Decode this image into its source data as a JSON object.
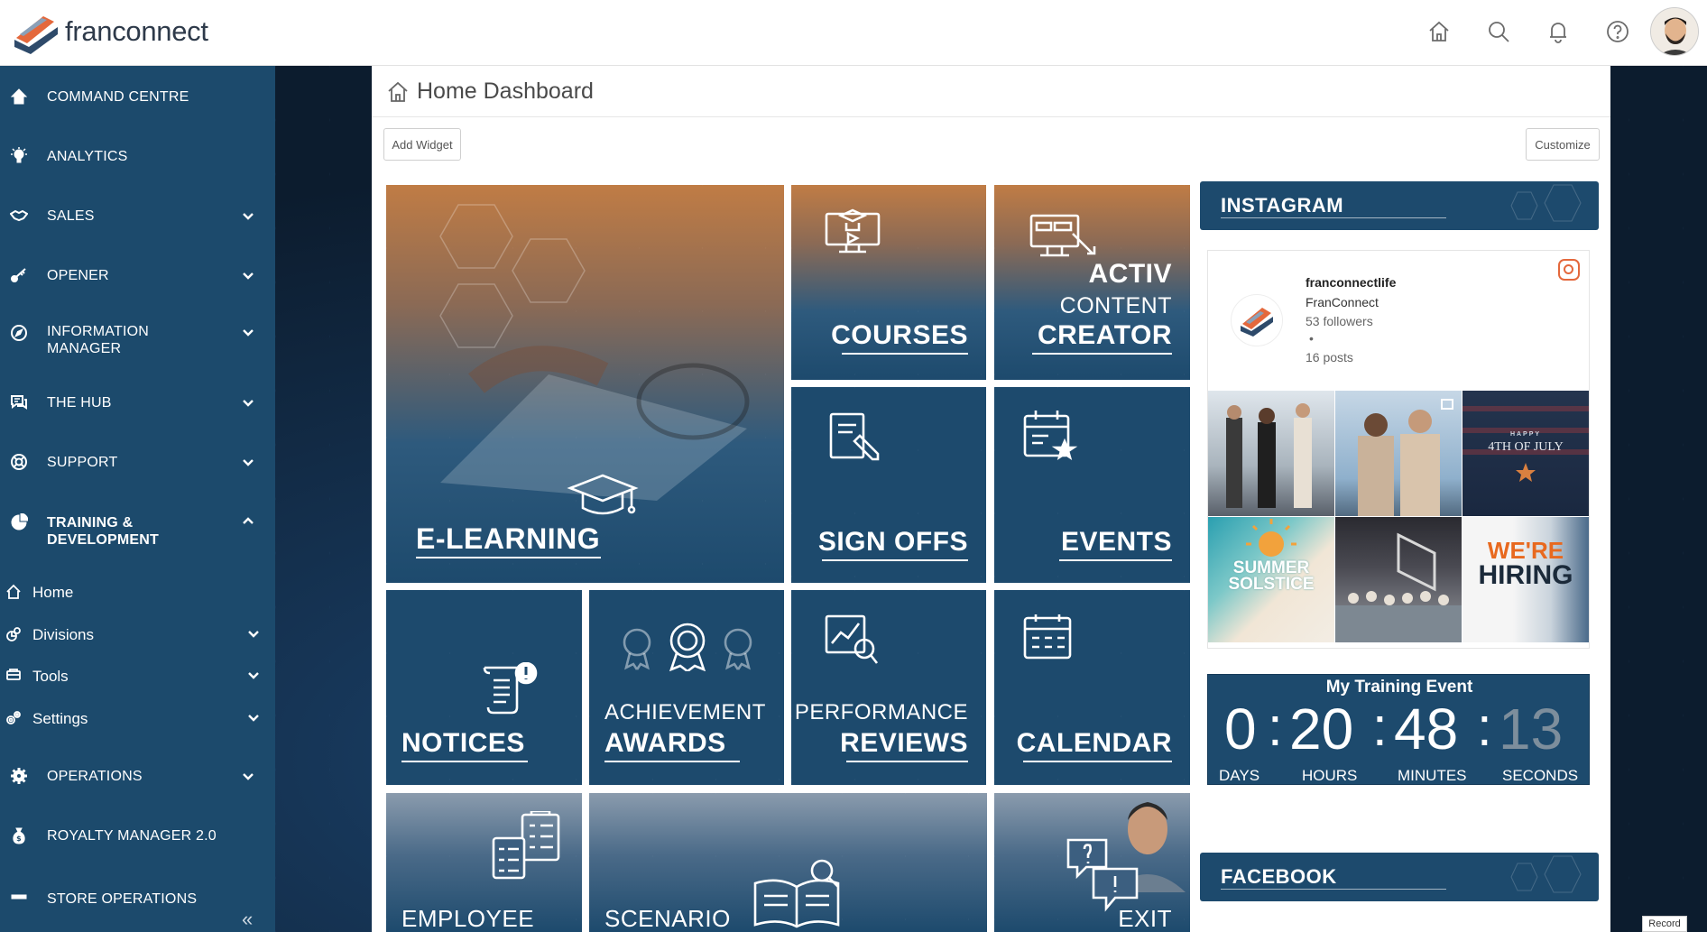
{
  "brand": {
    "logo_text": "franconnect",
    "accent": "#1d4a6d",
    "sidebar_bg": "#1c4a6c",
    "orange": "#e4683c"
  },
  "header_icons": [
    "home-icon",
    "search-icon",
    "bell-icon",
    "help-icon"
  ],
  "sidebar": {
    "items": [
      {
        "label": "COMMAND CENTRE",
        "icon": "home-icon"
      },
      {
        "label": "ANALYTICS",
        "icon": "lightbulb-icon"
      },
      {
        "label": "SALES",
        "icon": "handshake-icon"
      },
      {
        "label": "OPENER",
        "icon": "key-icon"
      },
      {
        "label": "INFORMATION",
        "label2": "MANAGER",
        "icon": "compass-icon"
      },
      {
        "label": "THE HUB",
        "icon": "chat-icon"
      },
      {
        "label": "SUPPORT",
        "icon": "lifebuoy-icon"
      },
      {
        "label": "TRAINING &",
        "label2": "DEVELOPMENT",
        "icon": "pie-icon"
      },
      {
        "label": "OPERATIONS",
        "icon": "gear-icon"
      },
      {
        "label": "ROYALTY MANAGER 2.0",
        "icon": "moneybag-icon"
      },
      {
        "label": "STORE OPERATIONS",
        "icon": "store-icon"
      }
    ],
    "subitems": [
      {
        "label": "Home"
      },
      {
        "label": "Divisions"
      },
      {
        "label": "Tools"
      },
      {
        "label": "Settings"
      }
    ],
    "collapse_glyph": "«"
  },
  "page": {
    "title": "Home Dashboard",
    "add_widget": "Add Widget",
    "customize": "Customize"
  },
  "tiles": {
    "elearning": "E-LEARNING",
    "courses": "COURSES",
    "activ": "ACTIV",
    "content": "CONTENT",
    "creator": "CREATOR",
    "signoffs": "SIGN OFFS",
    "events": "EVENTS",
    "notices": "NOTICES",
    "achievement": "ACHIEVEMENT",
    "awards": "AWARDS",
    "performance": "PERFORMANCE",
    "reviews": "REVIEWS",
    "calendar": "CALENDAR",
    "employee": "EMPLOYEE",
    "scenario": "SCENARIO",
    "exit": "EXIT"
  },
  "instagram": {
    "heading": "INSTAGRAM",
    "username": "franconnectlife",
    "name": "FranConnect",
    "followers": "53 followers",
    "dot": "•",
    "posts": "16 posts",
    "tile_july_small": "HAPPY",
    "tile_july": "4TH OF JULY",
    "tile_summer": "SUMMER SOLSTICE",
    "tile_hiring_1": "WE'RE",
    "tile_hiring_2": "HIRING"
  },
  "countdown": {
    "title": "My Training Event",
    "days": "0",
    "hours": "20",
    "minutes": "48",
    "seconds": "13",
    "sep": ":",
    "days_label": "DAYS",
    "hours_label": "HOURS",
    "minutes_label": "MINUTES",
    "seconds_label": "SECONDS"
  },
  "facebook": {
    "heading": "FACEBOOK"
  },
  "record": "Record"
}
